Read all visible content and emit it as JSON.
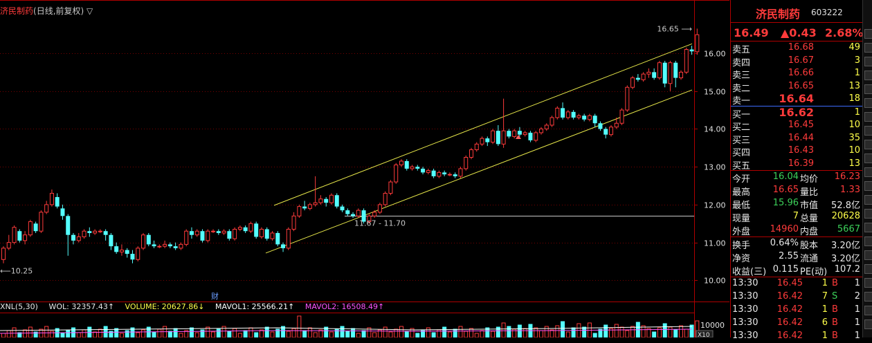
{
  "chart": {
    "stock_name": "济民制药",
    "mode_label": "(日线,前复权)",
    "mode_arrow": "▽",
    "high_marker": "16.65",
    "low_marker": "10.25",
    "range_label": "11.67 - 11.70",
    "cai_label": "财",
    "y_ticks": [
      "16.00",
      "15.00",
      "14.00",
      "13.00",
      "12.00",
      "11.00",
      "10.00"
    ],
    "vol_tick": "10000",
    "vol_unit": "X10"
  },
  "indicators": {
    "name": "XNL(5,30)",
    "wol": "WOL: 32357.43↑",
    "volume": "VOLUME: 20627.86↓",
    "mavol1": "MAVOL1: 25566.21↑",
    "mavol2": "MAVOL2: 16508.49↑"
  },
  "chart_data": {
    "type": "candlestick",
    "ylim": [
      9.55,
      16.95
    ],
    "candles": [
      [
        10.55,
        10.85,
        10.45,
        10.9
      ],
      [
        10.85,
        11.0,
        10.8,
        11.2
      ],
      [
        11.0,
        11.4,
        10.95,
        11.45
      ],
      [
        11.3,
        11.05,
        11.0,
        11.35
      ],
      [
        11.05,
        11.2,
        10.95,
        11.3
      ],
      [
        11.2,
        11.55,
        11.15,
        11.6
      ],
      [
        11.5,
        11.3,
        11.25,
        11.55
      ],
      [
        11.3,
        11.8,
        11.25,
        11.85
      ],
      [
        11.8,
        12.0,
        11.75,
        12.1
      ],
      [
        12.0,
        12.3,
        11.95,
        12.4
      ],
      [
        12.2,
        11.95,
        11.9,
        12.3
      ],
      [
        11.9,
        11.7,
        11.6,
        12.0
      ],
      [
        11.7,
        11.2,
        10.65,
        11.75
      ],
      [
        11.2,
        11.05,
        10.95,
        11.25
      ],
      [
        11.05,
        11.15,
        11.0,
        11.25
      ],
      [
        11.15,
        11.3,
        11.1,
        11.35
      ],
      [
        11.3,
        11.25,
        11.15,
        11.4
      ],
      [
        11.25,
        11.3,
        11.2,
        11.35
      ],
      [
        11.3,
        11.3,
        11.25,
        11.35
      ],
      [
        11.3,
        11.2,
        11.05,
        11.35
      ],
      [
        11.2,
        10.9,
        10.8,
        11.25
      ],
      [
        10.9,
        10.75,
        10.7,
        11.0
      ],
      [
        10.75,
        10.8,
        10.65,
        10.95
      ],
      [
        10.8,
        10.7,
        10.6,
        10.85
      ],
      [
        10.7,
        10.55,
        10.45,
        10.8
      ],
      [
        10.55,
        10.85,
        10.5,
        10.9
      ],
      [
        10.85,
        11.2,
        10.8,
        11.25
      ],
      [
        11.2,
        10.95,
        10.9,
        11.25
      ],
      [
        10.95,
        10.9,
        10.85,
        11.05
      ],
      [
        10.9,
        10.9,
        10.85,
        10.95
      ],
      [
        10.9,
        10.95,
        10.85,
        11.05
      ],
      [
        10.95,
        10.9,
        10.85,
        11.0
      ],
      [
        10.9,
        10.85,
        10.8,
        11.0
      ],
      [
        10.85,
        10.95,
        10.8,
        11.0
      ],
      [
        10.95,
        11.3,
        10.9,
        11.35
      ],
      [
        11.3,
        11.2,
        11.1,
        11.4
      ],
      [
        11.2,
        11.3,
        11.15,
        11.35
      ],
      [
        11.3,
        11.05,
        11.0,
        11.35
      ],
      [
        11.05,
        11.3,
        11.0,
        11.35
      ],
      [
        11.3,
        11.3,
        11.25,
        11.35
      ],
      [
        11.3,
        11.25,
        11.2,
        11.35
      ],
      [
        11.25,
        11.3,
        11.2,
        11.35
      ],
      [
        11.3,
        11.1,
        11.05,
        11.35
      ],
      [
        11.1,
        11.35,
        11.05,
        11.4
      ],
      [
        11.35,
        11.4,
        11.3,
        11.45
      ],
      [
        11.4,
        11.3,
        11.25,
        11.45
      ],
      [
        11.3,
        11.5,
        11.25,
        11.55
      ],
      [
        11.5,
        11.15,
        11.1,
        11.55
      ],
      [
        11.15,
        11.35,
        11.1,
        11.4
      ],
      [
        11.35,
        11.1,
        11.05,
        11.4
      ],
      [
        11.1,
        11.25,
        11.05,
        11.3
      ],
      [
        11.25,
        10.95,
        10.9,
        11.3
      ],
      [
        10.95,
        10.85,
        10.75,
        11.0
      ],
      [
        10.85,
        11.35,
        10.8,
        11.4
      ],
      [
        11.35,
        11.7,
        11.3,
        11.8
      ],
      [
        11.7,
        11.95,
        11.65,
        12.0
      ],
      [
        11.95,
        11.9,
        11.85,
        12.1
      ],
      [
        11.9,
        12.0,
        11.85,
        12.05
      ],
      [
        12.0,
        12.05,
        11.95,
        12.75
      ],
      [
        12.05,
        12.15,
        12.0,
        12.25
      ],
      [
        12.15,
        12.05,
        11.95,
        12.2
      ],
      [
        12.05,
        12.25,
        12.0,
        12.3
      ],
      [
        12.25,
        11.95,
        11.9,
        12.3
      ],
      [
        11.95,
        11.85,
        11.8,
        12.0
      ],
      [
        11.85,
        11.75,
        11.7,
        11.9
      ],
      [
        11.75,
        11.7,
        11.65,
        11.8
      ],
      [
        11.7,
        11.85,
        11.65,
        11.9
      ],
      [
        11.85,
        11.55,
        11.5,
        11.9
      ],
      [
        11.55,
        11.7,
        11.5,
        11.75
      ],
      [
        11.7,
        11.8,
        11.65,
        11.85
      ],
      [
        11.8,
        12.0,
        11.75,
        12.05
      ],
      [
        12.0,
        12.3,
        11.95,
        12.35
      ],
      [
        12.3,
        12.6,
        12.25,
        12.65
      ],
      [
        12.6,
        13.05,
        12.55,
        13.1
      ],
      [
        13.05,
        13.15,
        13.0,
        13.2
      ],
      [
        13.15,
        12.95,
        12.9,
        13.2
      ],
      [
        12.95,
        13.0,
        12.9,
        13.05
      ],
      [
        13.0,
        12.95,
        12.9,
        13.05
      ],
      [
        12.95,
        12.85,
        12.8,
        13.0
      ],
      [
        12.85,
        12.9,
        12.8,
        12.95
      ],
      [
        12.9,
        12.75,
        12.7,
        12.95
      ],
      [
        12.75,
        12.85,
        12.7,
        12.9
      ],
      [
        12.85,
        12.8,
        12.75,
        12.9
      ],
      [
        12.8,
        12.8,
        12.75,
        12.85
      ],
      [
        12.8,
        12.75,
        12.7,
        12.85
      ],
      [
        12.75,
        12.95,
        12.7,
        13.0
      ],
      [
        12.95,
        13.25,
        12.9,
        13.3
      ],
      [
        13.25,
        13.45,
        13.2,
        13.5
      ],
      [
        13.45,
        13.6,
        13.4,
        13.65
      ],
      [
        13.6,
        13.75,
        13.55,
        13.8
      ],
      [
        13.75,
        13.65,
        13.55,
        13.8
      ],
      [
        13.65,
        13.95,
        13.6,
        14.0
      ],
      [
        13.95,
        13.6,
        13.55,
        14.1
      ],
      [
        13.6,
        13.95,
        13.5,
        14.8
      ],
      [
        13.95,
        13.8,
        13.75,
        14.0
      ],
      [
        13.8,
        13.95,
        13.75,
        14.0
      ],
      [
        13.95,
        13.85,
        13.8,
        14.05
      ],
      [
        13.85,
        13.9,
        13.8,
        13.95
      ],
      [
        13.9,
        13.7,
        13.65,
        13.95
      ],
      [
        13.7,
        13.9,
        13.65,
        13.95
      ],
      [
        13.9,
        14.0,
        13.85,
        14.05
      ],
      [
        14.0,
        14.1,
        13.95,
        14.15
      ],
      [
        14.1,
        14.3,
        14.05,
        14.35
      ],
      [
        14.3,
        14.55,
        14.25,
        14.6
      ],
      [
        14.55,
        14.3,
        14.25,
        14.7
      ],
      [
        14.3,
        14.45,
        14.25,
        14.5
      ],
      [
        14.45,
        14.3,
        14.25,
        14.5
      ],
      [
        14.3,
        14.35,
        14.25,
        14.4
      ],
      [
        14.35,
        14.25,
        14.2,
        14.4
      ],
      [
        14.25,
        14.35,
        14.2,
        14.4
      ],
      [
        14.35,
        14.15,
        14.05,
        14.4
      ],
      [
        14.15,
        14.0,
        13.95,
        14.2
      ],
      [
        14.0,
        13.85,
        13.75,
        14.05
      ],
      [
        13.85,
        14.05,
        13.8,
        14.1
      ],
      [
        14.05,
        14.15,
        14.0,
        14.3
      ],
      [
        14.15,
        14.5,
        14.1,
        14.55
      ],
      [
        14.5,
        15.1,
        14.45,
        15.15
      ],
      [
        15.1,
        15.35,
        15.05,
        15.4
      ],
      [
        15.35,
        15.3,
        15.25,
        15.45
      ],
      [
        15.3,
        15.45,
        15.25,
        15.5
      ],
      [
        15.45,
        15.5,
        15.35,
        15.6
      ],
      [
        15.5,
        15.35,
        15.3,
        15.6
      ],
      [
        15.35,
        15.75,
        15.3,
        15.8
      ],
      [
        15.75,
        15.2,
        15.1,
        15.8
      ],
      [
        15.2,
        15.75,
        15.0,
        15.8
      ],
      [
        15.75,
        15.35,
        15.1,
        15.8
      ],
      [
        15.35,
        15.5,
        15.3,
        15.55
      ],
      [
        15.5,
        16.1,
        15.45,
        16.15
      ],
      [
        16.1,
        16.05,
        15.96,
        16.2
      ],
      [
        16.04,
        16.49,
        15.96,
        16.65
      ]
    ],
    "channel_upper": [
      [
        396,
        11.98
      ],
      [
        1000,
        16.25
      ]
    ],
    "channel_lower": [
      [
        384,
        10.72
      ],
      [
        1000,
        15.03
      ]
    ],
    "horizontal_line": 11.7
  },
  "panel": {
    "name": "济民制药",
    "code": "603222",
    "price": "16.49",
    "change": "▲0.43",
    "percent": "2.68%",
    "asks": [
      {
        "label": "卖五",
        "price": "16.68",
        "vol": "49"
      },
      {
        "label": "卖四",
        "price": "16.67",
        "vol": "3"
      },
      {
        "label": "卖三",
        "price": "16.66",
        "vol": "1"
      },
      {
        "label": "卖二",
        "price": "16.65",
        "vol": "13"
      },
      {
        "label": "卖一",
        "price": "16.64",
        "vol": "18"
      }
    ],
    "bids": [
      {
        "label": "买一",
        "price": "16.62",
        "vol": "1"
      },
      {
        "label": "买二",
        "price": "16.45",
        "vol": "10"
      },
      {
        "label": "买三",
        "price": "16.44",
        "vol": "35"
      },
      {
        "label": "买四",
        "price": "16.43",
        "vol": "10"
      },
      {
        "label": "买五",
        "price": "16.39",
        "vol": "13"
      }
    ],
    "stats1": [
      {
        "a": "今开",
        "b": "16.04",
        "c": "均价",
        "d": "16.23"
      },
      {
        "a": "最高",
        "b": "16.65",
        "c": "量比",
        "d": "1.33"
      },
      {
        "a": "最低",
        "b": "15.96",
        "c": "市值",
        "d": "52.8亿"
      },
      {
        "a": "现量",
        "b": "7",
        "c": "总量",
        "d": "20628"
      },
      {
        "a": "外盘",
        "b": "14960",
        "c": "内盘",
        "d": "5667"
      }
    ],
    "stats2": [
      {
        "a": "换手",
        "b": "0.64%",
        "c": "股本",
        "d": "3.20亿"
      },
      {
        "a": "净资",
        "b": "2.55",
        "c": "流通",
        "d": "3.20亿"
      },
      {
        "a": "收益(三)",
        "b": "0.115",
        "c": "PE(动)",
        "d": "107.2"
      }
    ],
    "ticks": [
      {
        "t": "13:30",
        "p": "16.45",
        "v": "1",
        "s": "B",
        "n": "1"
      },
      {
        "t": "13:30",
        "p": "16.42",
        "v": "7",
        "s": "S",
        "n": "2"
      },
      {
        "t": "13:30",
        "p": "16.42",
        "v": "1",
        "s": "B",
        "n": "1"
      },
      {
        "t": "13:30",
        "p": "16.42",
        "v": "6",
        "s": "B",
        "n": "1"
      },
      {
        "t": "13:30",
        "p": "16.42",
        "v": "1",
        "s": "B",
        "n": "1"
      }
    ]
  }
}
